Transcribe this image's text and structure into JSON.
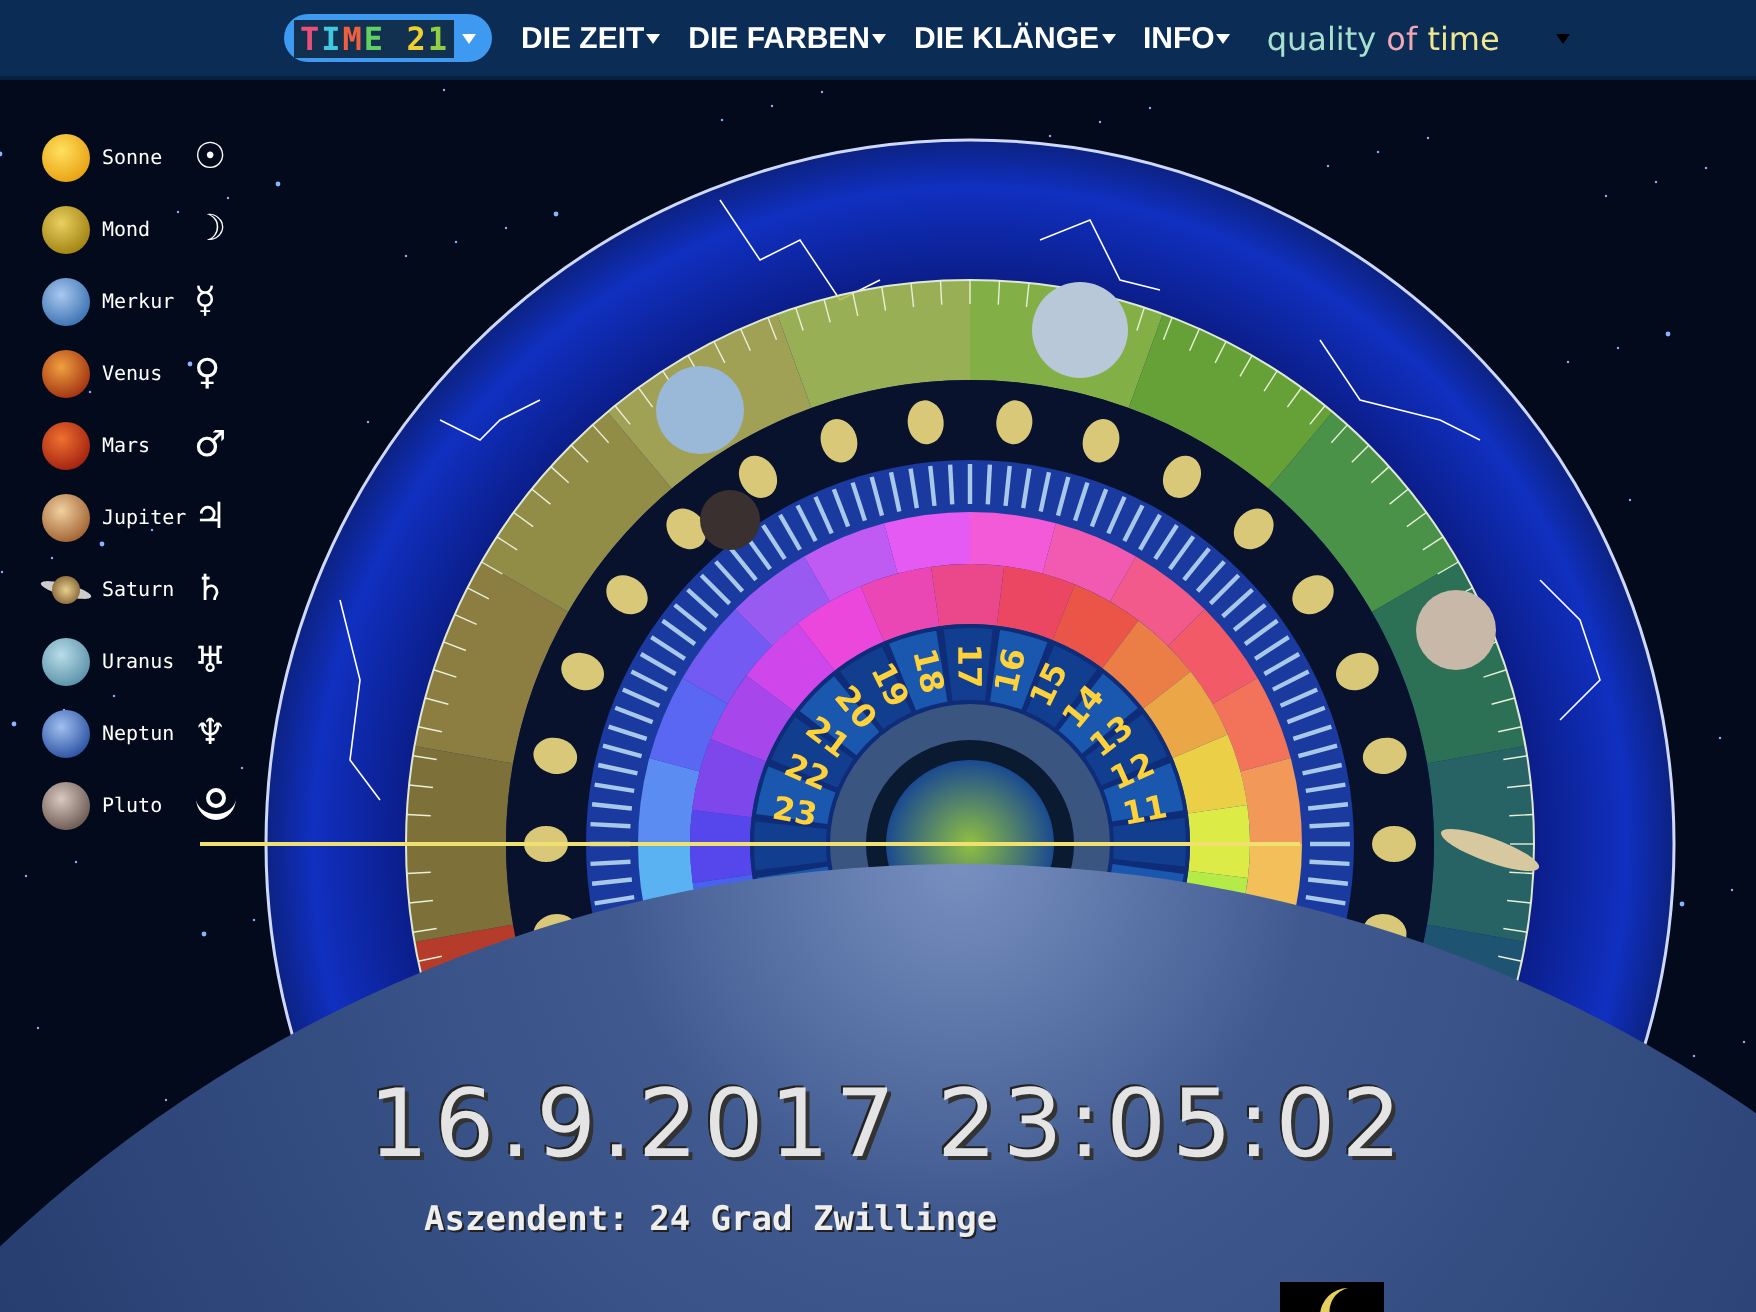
{
  "nav": {
    "logo": "TIME 21",
    "items": [
      "DIE ZEIT",
      "DIE FARBEN",
      "DIE KLÄNGE",
      "INFO"
    ],
    "tagline": [
      "quality",
      "of",
      "time"
    ]
  },
  "planets": [
    {
      "name": "Sonne",
      "kind": "sphere",
      "symbol": "☉"
    },
    {
      "name": "Mond",
      "kind": "sphere",
      "symbol": "☽"
    },
    {
      "name": "Merkur",
      "kind": "sphere",
      "symbol": "☿"
    },
    {
      "name": "Venus",
      "kind": "sphere",
      "symbol": "♀"
    },
    {
      "name": "Mars",
      "kind": "sphere",
      "symbol": "♂"
    },
    {
      "name": "Jupiter",
      "kind": "sphere",
      "symbol": "♃"
    },
    {
      "name": "Saturn",
      "kind": "ringed",
      "symbol": "♄"
    },
    {
      "name": "Uranus",
      "kind": "sphere",
      "symbol": "♅"
    },
    {
      "name": "Neptun",
      "kind": "sphere",
      "symbol": "♆"
    },
    {
      "name": "Pluto",
      "kind": "sphere"
    }
  ],
  "wheel": {
    "hours": [
      "11",
      "12",
      "13",
      "14",
      "15",
      "16",
      "17",
      "18",
      "19",
      "20",
      "21",
      "22",
      "23"
    ]
  },
  "datetime": "16.9.2017 23:05:02",
  "ascendant": "Aszendent: 24 Grad Zwillinge"
}
